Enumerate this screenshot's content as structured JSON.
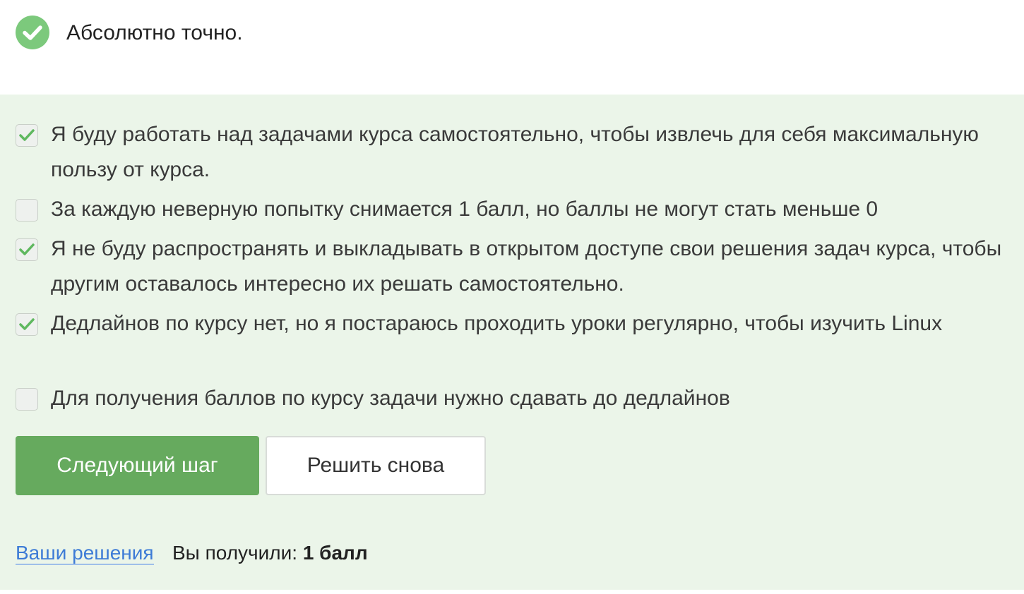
{
  "result": {
    "icon": "check-circle-icon",
    "text": "Абсолютно точно.",
    "color": "#7cc97c"
  },
  "options": [
    {
      "checked": true,
      "text": "Я буду работать над задачами курса самостоятельно, чтобы извлечь для себя максимальную пользу от курса."
    },
    {
      "checked": false,
      "text": "За каждую неверную попытку снимается 1 балл, но баллы не могут стать меньше 0"
    },
    {
      "checked": true,
      "text": "Я не буду распространять и выкладывать в открытом доступе свои решения задач курса, чтобы другим оставалось интересно их решать самостоятельно."
    },
    {
      "checked": true,
      "text": "Дедлайнов по курсу нет, но я постараюсь проходить уроки регулярно, чтобы изучить Linux"
    },
    {
      "checked": false,
      "text": "Для получения баллов по курсу задачи нужно сдавать до дедлайнов"
    }
  ],
  "buttons": {
    "next_label": "Следующий шаг",
    "retry_label": "Решить снова"
  },
  "footer": {
    "solutions_link": "Ваши решения",
    "score_prefix": "Вы получили:",
    "score_value": "1 балл"
  },
  "colors": {
    "accent": "#66aa5e",
    "panel_bg": "#ebf5e9",
    "link": "#3d7bd6"
  }
}
